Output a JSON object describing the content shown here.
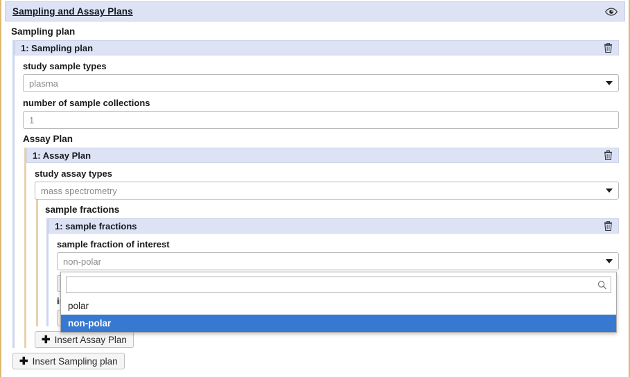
{
  "panel": {
    "title": "Sampling and Assay Plans",
    "visibility_icon": "eye-icon"
  },
  "sampling_plan": {
    "group_label": "Sampling plan",
    "item_header": "1: Sampling plan",
    "delete_icon": "trash-icon",
    "fields": [
      {
        "label": "study sample types",
        "type": "select",
        "value": "plasma"
      },
      {
        "label": "number of sample collections",
        "type": "text",
        "value": "1"
      }
    ],
    "insert_button": "Insert Sampling plan"
  },
  "assay_plan": {
    "group_label": "Assay Plan",
    "item_header": "1: Assay Plan",
    "delete_icon": "trash-icon",
    "fields": [
      {
        "label": "study assay types",
        "type": "select",
        "value": "mass spectrometry"
      }
    ],
    "insert_button": "Insert Assay Plan"
  },
  "sample_fractions": {
    "group_label": "sample fractions",
    "item_header": "1: sample fractions",
    "delete_icon": "trash-icon",
    "field": {
      "label": "sample fraction of interest",
      "type": "select",
      "value": "non-polar"
    },
    "insert_button_occluded": "+",
    "next_label_occluded": "in",
    "insert_button_occluded_2": "+"
  },
  "dropdown": {
    "open": true,
    "search_value": "",
    "search_placeholder": "",
    "search_icon": "search-icon",
    "options": [
      {
        "label": "polar",
        "selected": false
      },
      {
        "label": "non-polar",
        "selected": true
      }
    ],
    "highlight_color": "#3778d0"
  },
  "colors": {
    "header_blue": "#dde3f5",
    "border_gold": "#ddb870",
    "border_blue": "#ccd6ef",
    "border_tan": "#e6d2ad",
    "selection": "#3778d0"
  }
}
